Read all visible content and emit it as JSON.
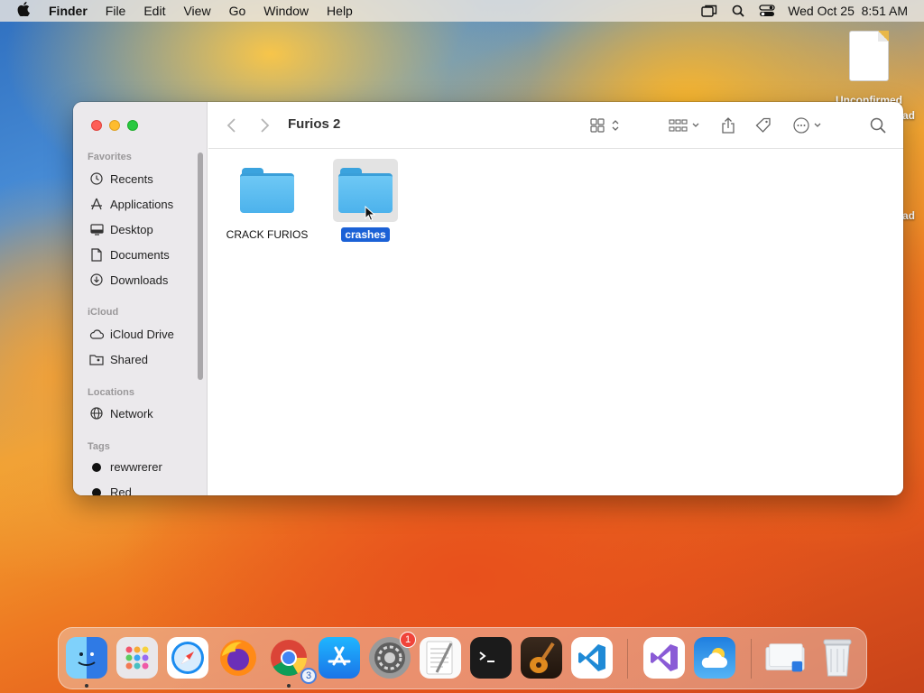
{
  "menubar": {
    "app": "Finder",
    "items": [
      "File",
      "Edit",
      "View",
      "Go",
      "Window",
      "Help"
    ],
    "datetime": "Wed Oct 25  8:51 AM",
    "icons": [
      "screen-mirror-icon",
      "spotlight-icon",
      "control-center-icon"
    ]
  },
  "desktop": {
    "file_label": "Unconfirmed",
    "file_label_fragment_top": "ad",
    "file_label_fragment_side": "ad"
  },
  "window": {
    "title": "Furios 2",
    "sidebar": {
      "favorites_title": "Favorites",
      "favorites": [
        {
          "label": "Recents",
          "icon": "clock-icon"
        },
        {
          "label": "Applications",
          "icon": "applications-icon"
        },
        {
          "label": "Desktop",
          "icon": "desktop-icon"
        },
        {
          "label": "Documents",
          "icon": "document-icon"
        },
        {
          "label": "Downloads",
          "icon": "download-icon"
        }
      ],
      "icloud_title": "iCloud",
      "icloud": [
        {
          "label": "iCloud Drive",
          "icon": "cloud-icon"
        },
        {
          "label": "Shared",
          "icon": "shared-folder-icon"
        }
      ],
      "locations_title": "Locations",
      "locations": [
        {
          "label": "Network",
          "icon": "globe-icon"
        }
      ],
      "tags_title": "Tags",
      "tags": [
        {
          "label": "rewwrerer",
          "color": "#111111"
        },
        {
          "label": "Red",
          "color": "#111111"
        }
      ]
    },
    "items": [
      {
        "name": "CRACK FURIOS",
        "selected": false
      },
      {
        "name": "crashes",
        "selected": true
      }
    ]
  },
  "dock": {
    "apps": [
      "Finder",
      "Launchpad",
      "Safari",
      "Firefox",
      "Chrome",
      "App Store",
      "System Settings",
      "TextEdit",
      "Terminal",
      "GarageBand",
      "Visual Studio Code",
      "Visual Studio",
      "Weather",
      "Downloads stack",
      "Trash"
    ],
    "chrome_badge": "3",
    "settings_badge": "1"
  },
  "colors": {
    "selection": "#1b61d6",
    "folder": "#4cb2ec"
  }
}
